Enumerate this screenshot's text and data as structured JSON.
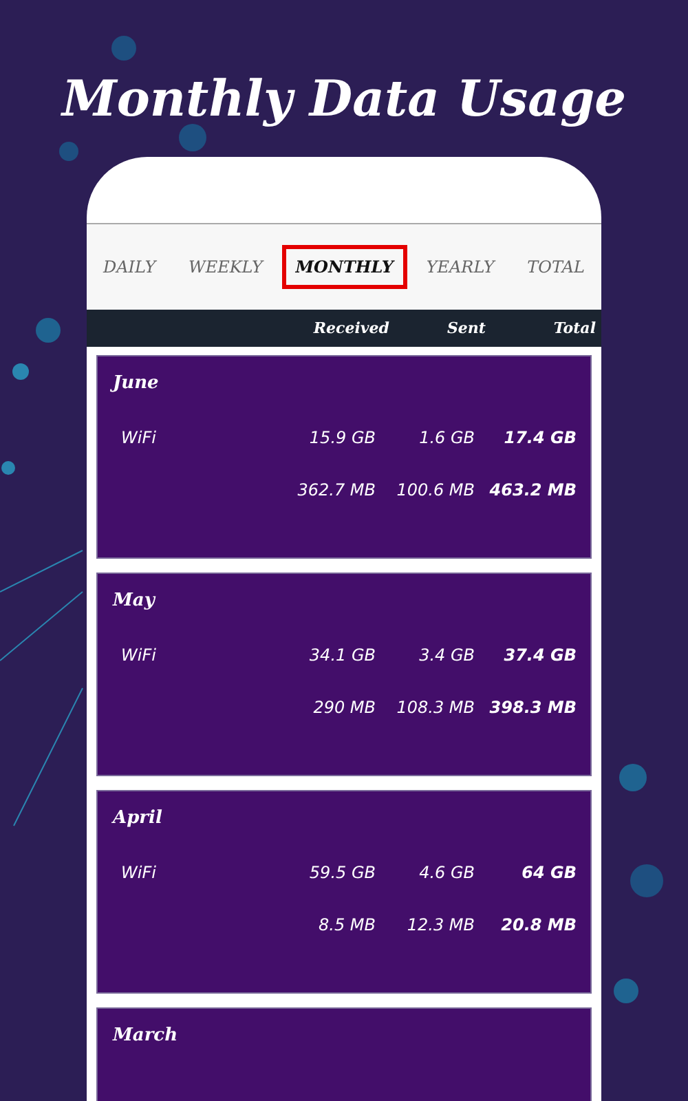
{
  "headline": "Monthly Data Usage",
  "tabs": [
    {
      "label": "DAILY",
      "selected": false
    },
    {
      "label": "WEEKLY",
      "selected": false
    },
    {
      "label": "MONTHLY",
      "selected": true
    },
    {
      "label": "YEARLY",
      "selected": false
    },
    {
      "label": "TOTAL",
      "selected": false
    }
  ],
  "columns": [
    "Received",
    "Sent",
    "Total"
  ],
  "months": [
    {
      "name": "June",
      "rows": [
        {
          "label": "WiFi",
          "received": "15.9 GB",
          "sent": "1.6 GB",
          "total": "17.4 GB"
        },
        {
          "received": "362.7 MB",
          "sent": "100.6 MB",
          "total": "463.2 MB"
        }
      ]
    },
    {
      "name": "May",
      "rows": [
        {
          "label": "WiFi",
          "received": "34.1 GB",
          "sent": "3.4 GB",
          "total": "37.4 GB"
        },
        {
          "received": "290 MB",
          "sent": "108.3 MB",
          "total": "398.3 MB"
        }
      ]
    },
    {
      "name": "April",
      "rows": [
        {
          "label": "WiFi",
          "received": "59.5 GB",
          "sent": "4.6 GB",
          "total": "64 GB"
        },
        {
          "received": "8.5 MB",
          "sent": "12.3 MB",
          "total": "20.8 MB"
        }
      ]
    },
    {
      "name": "March"
    }
  ]
}
